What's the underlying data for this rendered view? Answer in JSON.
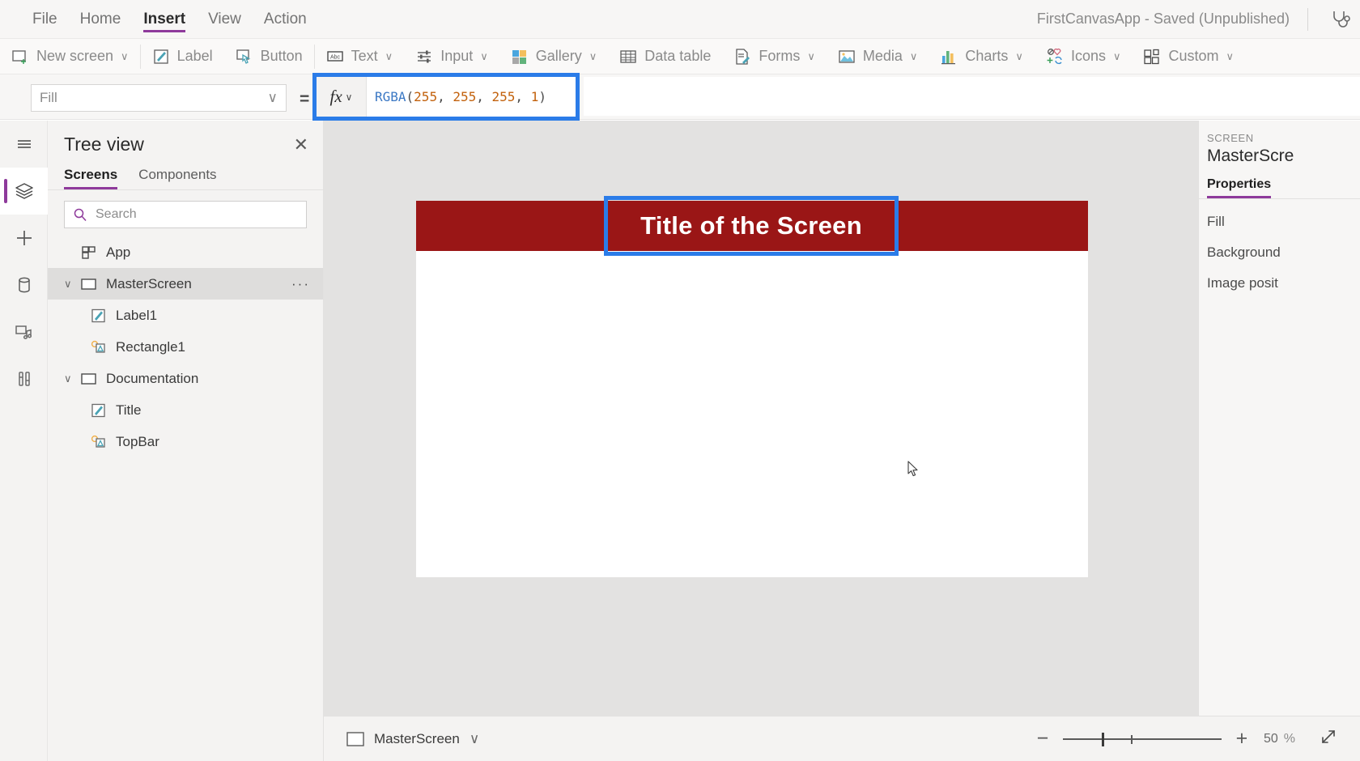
{
  "titlebar": {
    "menu": [
      {
        "label": "File",
        "active": false
      },
      {
        "label": "Home",
        "active": false
      },
      {
        "label": "Insert",
        "active": true
      },
      {
        "label": "View",
        "active": false
      },
      {
        "label": "Action",
        "active": false
      }
    ],
    "app_status": "FirstCanvasApp - Saved (Unpublished)",
    "help_icon": "stethoscope-icon"
  },
  "ribbon": {
    "items": [
      {
        "label": "New screen",
        "icon": "new-screen-icon",
        "chevron": true
      },
      {
        "label": "Label",
        "icon": "label-icon",
        "chevron": false
      },
      {
        "label": "Button",
        "icon": "button-icon",
        "chevron": false
      },
      {
        "label": "Text",
        "icon": "text-abc-icon",
        "chevron": true
      },
      {
        "label": "Input",
        "icon": "input-sliders-icon",
        "chevron": true
      },
      {
        "label": "Gallery",
        "icon": "gallery-icon",
        "chevron": true
      },
      {
        "label": "Data table",
        "icon": "data-table-icon",
        "chevron": false
      },
      {
        "label": "Forms",
        "icon": "forms-icon",
        "chevron": true
      },
      {
        "label": "Media",
        "icon": "media-image-icon",
        "chevron": true
      },
      {
        "label": "Charts",
        "icon": "charts-bar-icon",
        "chevron": true
      },
      {
        "label": "Icons",
        "icon": "icons-shapes-icon",
        "chevron": true
      },
      {
        "label": "Custom",
        "icon": "custom-components-icon",
        "chevron": true
      }
    ],
    "chevron_glyph": "∨"
  },
  "formula_bar": {
    "property_value": "Fill",
    "equals": "=",
    "fx_label": "fx",
    "fx_chevron": "∨",
    "chevron_glyph": "∨",
    "expression": {
      "function_name": "RGBA",
      "open_paren": "(",
      "args": [
        "255",
        "255",
        "255",
        "1"
      ],
      "separator": ", ",
      "close_paren": ")",
      "full_text": "RGBA(255, 255, 255, 1)"
    },
    "highlight_color": "#2b7ce8"
  },
  "left_rail": {
    "items": [
      {
        "name": "hamburger-menu-icon",
        "active": false
      },
      {
        "name": "tree-view-layers-icon",
        "active": true
      },
      {
        "name": "insert-plus-icon",
        "active": false
      },
      {
        "name": "data-database-icon",
        "active": false
      },
      {
        "name": "media-icon",
        "active": false
      },
      {
        "name": "advanced-tools-icon",
        "active": false
      }
    ],
    "accent_color": "#8e3a9b"
  },
  "tree_view": {
    "title": "Tree view",
    "close_glyph": "✕",
    "tabs": [
      {
        "label": "Screens",
        "active": true
      },
      {
        "label": "Components",
        "active": false
      }
    ],
    "search_placeholder": "Search",
    "nodes": [
      {
        "label": "App",
        "icon": "app-grid-icon",
        "indent": 0,
        "twisty": "",
        "selected": false,
        "more": false
      },
      {
        "label": "MasterScreen",
        "icon": "screen-icon",
        "indent": 0,
        "twisty": "∨",
        "selected": true,
        "more": true
      },
      {
        "label": "Label1",
        "icon": "label-control-icon",
        "indent": 1,
        "twisty": "",
        "selected": false,
        "more": false
      },
      {
        "label": "Rectangle1",
        "icon": "shape-control-icon",
        "indent": 1,
        "twisty": "",
        "selected": false,
        "more": false
      },
      {
        "label": "Documentation",
        "icon": "screen-icon",
        "indent": 0,
        "twisty": "∨",
        "selected": false,
        "more": false
      },
      {
        "label": "Title",
        "icon": "label-control-icon",
        "indent": 1,
        "twisty": "",
        "selected": false,
        "more": false
      },
      {
        "label": "TopBar",
        "icon": "shape-control-icon",
        "indent": 1,
        "twisty": "",
        "selected": false,
        "more": false
      }
    ],
    "more_glyph": "···"
  },
  "canvas": {
    "screen_background": "#ffffff",
    "topbar_color": "#9a1616",
    "title_text": "Title of the Screen",
    "title_color": "#ffffff",
    "selection_color": "#2b7ce8",
    "workspace_color": "#e3e2e1"
  },
  "properties_panel": {
    "kicker": "SCREEN",
    "name": "MasterScre",
    "tab": "Properties",
    "rows": [
      "Fill",
      "Background",
      "Image posit"
    ]
  },
  "status_bar": {
    "screen_name": "MasterScreen",
    "screen_chevron": "∨",
    "zoom_out": "−",
    "zoom_in": "+",
    "zoom_level": "50",
    "zoom_unit": "%",
    "fit_icon": "fit-to-screen-icon"
  }
}
